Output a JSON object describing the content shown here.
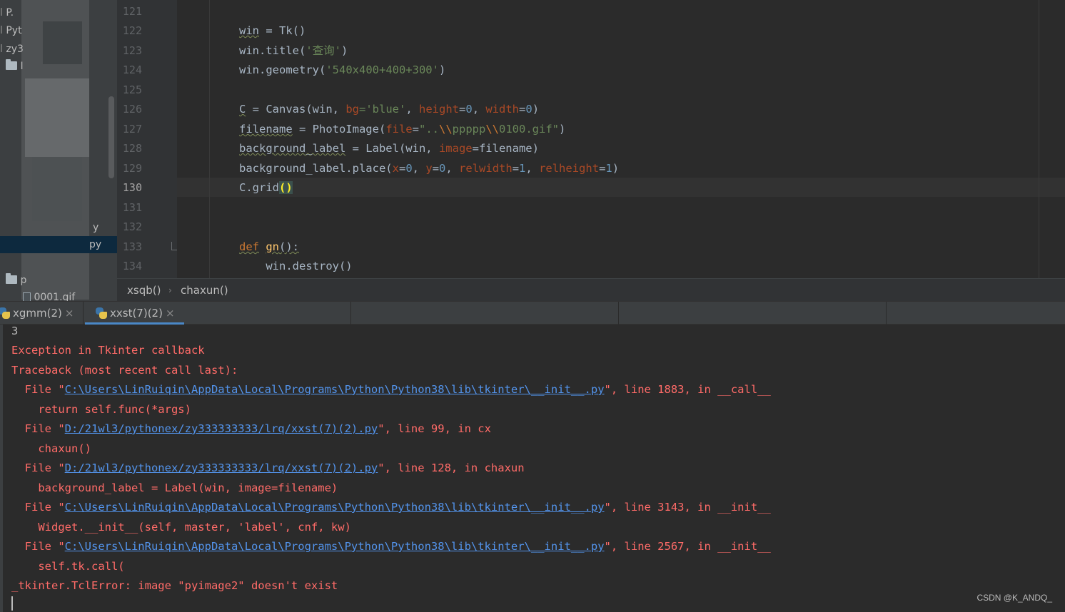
{
  "project_tree": {
    "rows": [
      "P.",
      "Pyt",
      "zy3",
      "I",
      "y",
      "py",
      "p",
      "0001.gif"
    ]
  },
  "editor": {
    "line_numbers": [
      "121",
      "122",
      "123",
      "124",
      "125",
      "126",
      "127",
      "128",
      "129",
      "130",
      "131",
      "132",
      "133",
      "134"
    ],
    "current_line": "130",
    "code": {
      "l122": {
        "win": "win",
        "rest": " = Tk()"
      },
      "l123": {
        "pre": "win.title(",
        "str": "'查询'",
        "post": ")"
      },
      "l124": {
        "pre": "win.geometry(",
        "str": "'540x400+400+300'",
        "post": ")"
      },
      "l126": {
        "c": "C",
        "eq": " = Canvas(win, ",
        "bg": "bg",
        "bgval": "='blue'",
        "comma1": ", ",
        "height": "height",
        "heightval": "=",
        "zero1": "0",
        "comma2": ", ",
        "width": "width",
        "widthval": "=",
        "zero2": "0",
        "close": ")"
      },
      "l127": {
        "var": "filename",
        "eq": " = PhotoImage(",
        "file": "file",
        "eqs": "=",
        "s1": "\"..",
        "e1": "\\\\",
        "s2": "ppppp",
        "e2": "\\\\",
        "s3": "0100.gif\"",
        "close": ")"
      },
      "l128": {
        "var": "background_label",
        "eq": " = Label(win, ",
        "image": "image",
        "rest": "=filename)"
      },
      "l129": {
        "pre": "background_label.place(",
        "x": "x",
        "eq1": "=",
        "v0a": "0",
        "c1": ", ",
        "y": "y",
        "eq2": "=",
        "v0b": "0",
        "c2": ", ",
        "rw": "relwidth",
        "eq3": "=",
        "v1a": "1",
        "c3": ", ",
        "rh": "relheight",
        "eq4": "=",
        "v1b": "1",
        "close": ")"
      },
      "l130": {
        "pre": "C.grid",
        "paren": "()"
      },
      "l133": {
        "def": "def",
        "sp": " ",
        "name": "gn",
        "rest": "():"
      },
      "l134": {
        "text": "    win.destroy()"
      }
    }
  },
  "breadcrumb": {
    "first": "xsqb()",
    "sep": "›",
    "second": "chaxun()"
  },
  "run_tabs": [
    {
      "label": "xgmm(2)",
      "close": "×"
    },
    {
      "label": "xxst(7)(2)",
      "close": "×"
    }
  ],
  "console": {
    "line0": "3",
    "line1": "Exception in Tkinter callback",
    "line2": "Traceback (most recent call last):",
    "f1_pre": "  File \"",
    "f1_link": "C:\\Users\\LinRuiqin\\AppData\\Local\\Programs\\Python\\Python38\\lib\\tkinter\\__init__.py",
    "f1_post": "\", line 1883, in __call__",
    "l4": "    return self.func(*args)",
    "f2_pre": "  File \"",
    "f2_link": "D:/21wl3/pythonex/zy333333333/lrq/xxst(7)(2).py",
    "f2_post": "\", line 99, in cx",
    "l6": "    chaxun()",
    "f3_pre": "  File \"",
    "f3_link": "D:/21wl3/pythonex/zy333333333/lrq/xxst(7)(2).py",
    "f3_post": "\", line 128, in chaxun",
    "l8": "    background_label = Label(win, image=filename)",
    "f4_pre": "  File \"",
    "f4_link": "C:\\Users\\LinRuiqin\\AppData\\Local\\Programs\\Python\\Python38\\lib\\tkinter\\__init__.py",
    "f4_post": "\", line 3143, in __init__",
    "l10": "    Widget.__init__(self, master, 'label', cnf, kw)",
    "f5_pre": "  File \"",
    "f5_link": "C:\\Users\\LinRuiqin\\AppData\\Local\\Programs\\Python\\Python38\\lib\\tkinter\\__init__.py",
    "f5_post": "\", line 2567, in __init__",
    "l12": "    self.tk.call(",
    "l13": "_tkinter.TclError: image \"pyimage2\" doesn't exist"
  },
  "watermark": "CSDN @K_ANDQ_",
  "colors": {
    "editor_bg": "#2b2b2b",
    "keyword": "#cc7832",
    "string": "#6a8759",
    "number": "#6897bb",
    "param": "#aa4926",
    "error": "#ff6b68",
    "link": "#5394ec",
    "tab_accent": "#4a88c7"
  }
}
